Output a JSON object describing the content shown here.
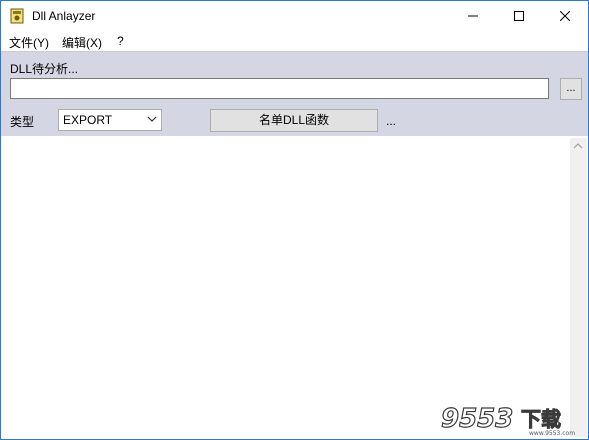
{
  "window": {
    "title": "Dll Anlayzer",
    "controls": {
      "minimize_icon": "minimize-icon",
      "maximize_icon": "maximize-icon",
      "close_icon": "close-icon"
    }
  },
  "menu": {
    "items": [
      {
        "label": "文件(Y)"
      },
      {
        "label": "编辑(X)"
      },
      {
        "label": "?"
      }
    ]
  },
  "panel": {
    "dll_label": "DLL待分析...",
    "path_value": "",
    "browse_label": "...",
    "type_label": "类型",
    "type_selected": "EXPORT",
    "list_button_label": "名单DLL函数",
    "ellipsis_label": "..."
  },
  "output": {
    "text": ""
  },
  "watermark": {
    "text": "9553下载",
    "site": "www.9553.com"
  },
  "colors": {
    "panel_bg": "#d4d6e3",
    "window_border": "#2b79d7",
    "button_bg": "#e1e1e1"
  }
}
